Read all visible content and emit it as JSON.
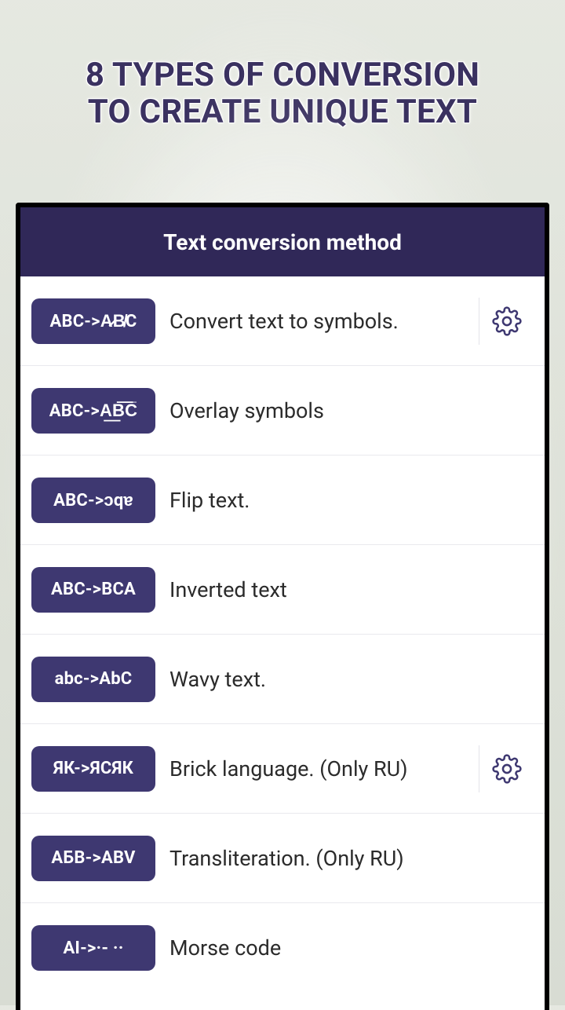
{
  "hero": {
    "line1": "8 TYPES OF CONVERSION",
    "line2": "TO CREATE UNIQUE TEXT"
  },
  "appbar": {
    "title": "Text conversion method"
  },
  "rows": [
    {
      "badge": "ABC->A̷B̸C",
      "label": "Convert text to symbols.",
      "has_settings": true
    },
    {
      "badge": "ABC->A͟B͞C̅",
      "label": "Overlay symbols",
      "has_settings": false
    },
    {
      "badge": "ABC->ɔqɐ",
      "label": "Flip text.",
      "has_settings": false
    },
    {
      "badge": "ABC->BCA",
      "label": "Inverted text",
      "has_settings": false
    },
    {
      "badge": "abc->AbC",
      "label": "Wavy text.",
      "has_settings": false
    },
    {
      "badge": "ЯК->ЯСЯК",
      "label": "Brick language. (Only RU)",
      "has_settings": true
    },
    {
      "badge": "АБВ->ABV",
      "label": "Transliteration. (Only RU)",
      "has_settings": false
    },
    {
      "badge": "AI->·- ··",
      "label": "Morse code",
      "has_settings": false
    }
  ],
  "colors": {
    "accent": "#3e3871",
    "appbar": "#302858"
  }
}
